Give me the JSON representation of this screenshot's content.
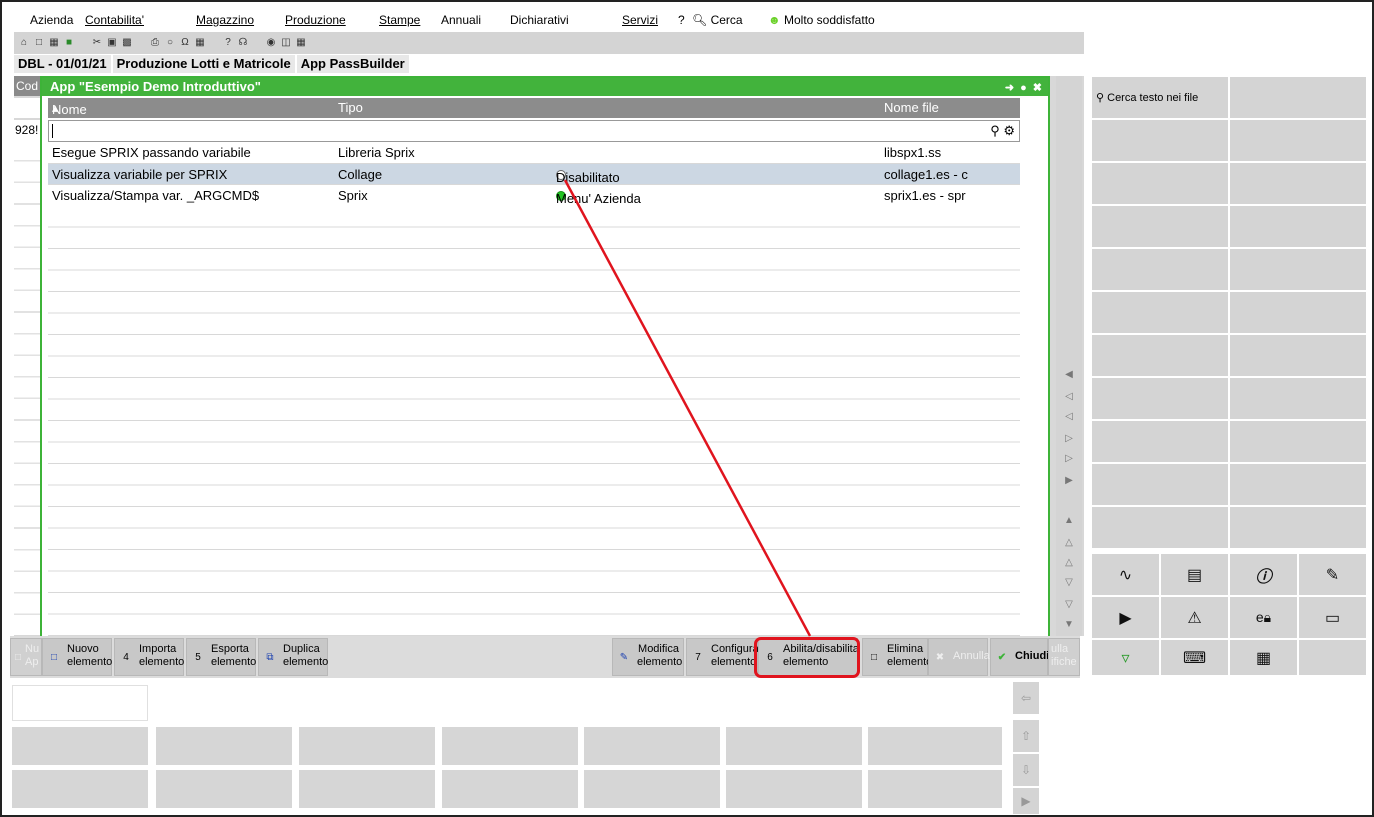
{
  "menu": [
    {
      "label": "Azienda"
    },
    {
      "label": "Contabilita'"
    },
    {
      "label": "Magazzino"
    },
    {
      "label": "Produzione"
    },
    {
      "label": "Stampe"
    },
    {
      "label": "Annuali"
    },
    {
      "label": "Dichiarativi"
    },
    {
      "label": "Servizi"
    },
    {
      "label": "?"
    },
    {
      "label": "Cerca"
    },
    {
      "label": "Molto soddisfatto"
    }
  ],
  "breadcrumbs": [
    "DBL - 01/01/21",
    "Produzione Lotti e Matricole",
    "App PassBuilder"
  ],
  "background_table": {
    "header": "Cod",
    "code_value": "928!"
  },
  "dialog": {
    "title": "App \"Esempio Demo Introduttivo\"",
    "columns": {
      "nome": "Nome",
      "tipo": "Tipo",
      "nome_file": "Nome file"
    },
    "filter_value": "",
    "rows": [
      {
        "nome": "Esegue SPRIX passando variabile",
        "tipo": "Libreria Sprix",
        "stato": "",
        "file": "libspx1.ss"
      },
      {
        "nome": "Visualizza variabile per SPRIX",
        "tipo": "Collage",
        "stato": "Disabilitato",
        "file": "collage1.es - c"
      },
      {
        "nome": "Visualizza/Stampa var. _ARGCMD$",
        "tipo": "Sprix",
        "stato": "Menu' Azienda",
        "file": "sprix1.es - spr"
      }
    ]
  },
  "right_panel": {
    "search_label": "Cerca testo nei file"
  },
  "buttons": {
    "left_ghost": {
      "line1": "Nu",
      "line2": "Ap"
    },
    "nuovo": {
      "line1": "Nuovo",
      "line2": "elemento"
    },
    "importa": {
      "key": "4",
      "line1": "Importa",
      "line2": "elemento"
    },
    "esporta": {
      "key": "5",
      "line1": "Esporta",
      "line2": "elemento"
    },
    "duplica": {
      "line1": "Duplica",
      "line2": "elemento"
    },
    "modifica": {
      "line1": "Modifica",
      "line2": "elemento"
    },
    "configura": {
      "key": "7",
      "line1": "Configura",
      "line2": "elemento"
    },
    "abilita": {
      "key": "6",
      "line1": "Abilita/disabilita",
      "line2": "elemento"
    },
    "elimina": {
      "line1": "Elimina",
      "line2": "elemento"
    },
    "annulla": {
      "label": "Annulla"
    },
    "chiudi": {
      "label": "Chiudi"
    },
    "right_ghost": {
      "line1": "ulla",
      "line2": "ifiche"
    }
  },
  "colors": {
    "dialog_green": "#42b33c",
    "highlight_red": "#e0141e",
    "selected_row": "#ccd7e3"
  }
}
